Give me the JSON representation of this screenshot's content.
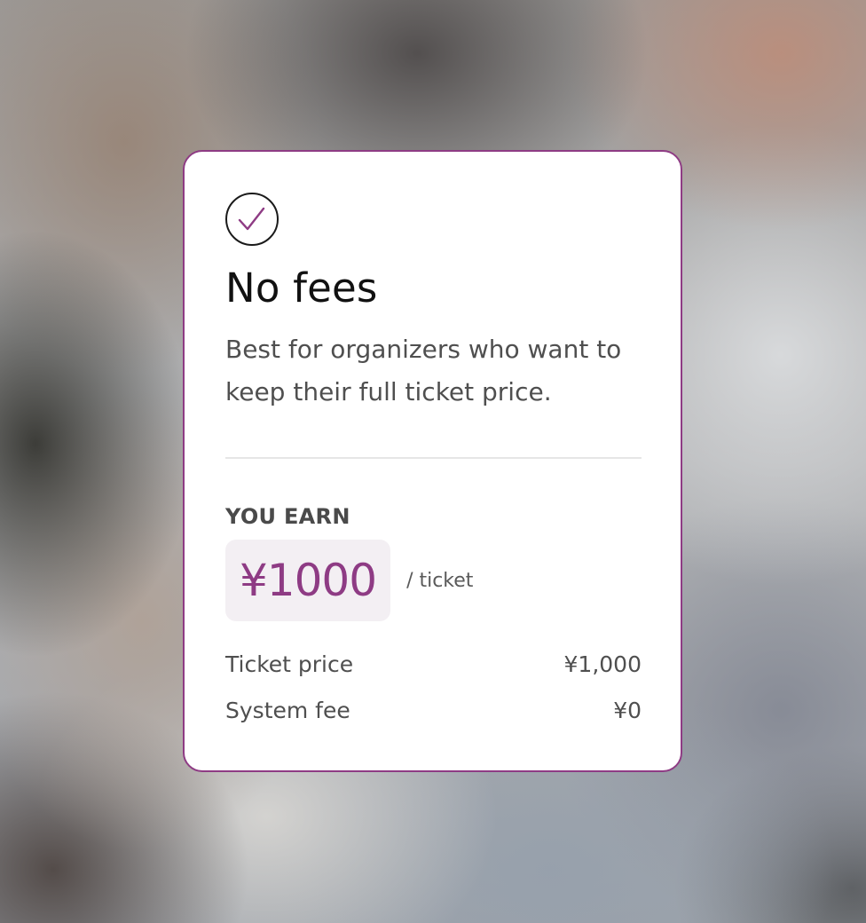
{
  "plan": {
    "icon": "check-icon",
    "title": "No fees",
    "description": "Best for organizers who want to keep their full ticket price.",
    "earn_label": "YOU EARN",
    "earn_amount": "¥1000",
    "earn_unit": "/ ticket",
    "breakdown": [
      {
        "label": "Ticket price",
        "value": "¥1,000"
      },
      {
        "label": "System fee",
        "value": "¥0"
      }
    ]
  },
  "colors": {
    "accent": "#8e3b84",
    "earn_background": "#f3eff3",
    "card_background": "#ffffff"
  }
}
